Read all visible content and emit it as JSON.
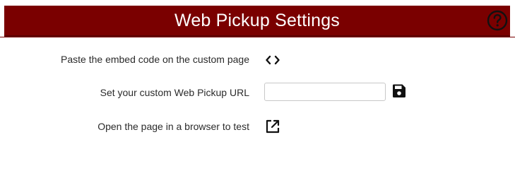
{
  "header": {
    "title": "Web Pickup Settings",
    "help_icon": "help-circle-icon"
  },
  "rows": [
    {
      "label": "Paste the embed code on the custom page",
      "icon": "code-icon"
    },
    {
      "label": "Set your custom Web Pickup URL",
      "input_value": "",
      "input_placeholder": "",
      "icon": "save-icon"
    },
    {
      "label": "Open the page in a browser to test",
      "icon": "external-link-icon"
    }
  ],
  "colors": {
    "header_bg": "#7a0000",
    "header_text": "#ffffff",
    "label_text": "#2b2b2b",
    "icon": "#111111"
  }
}
